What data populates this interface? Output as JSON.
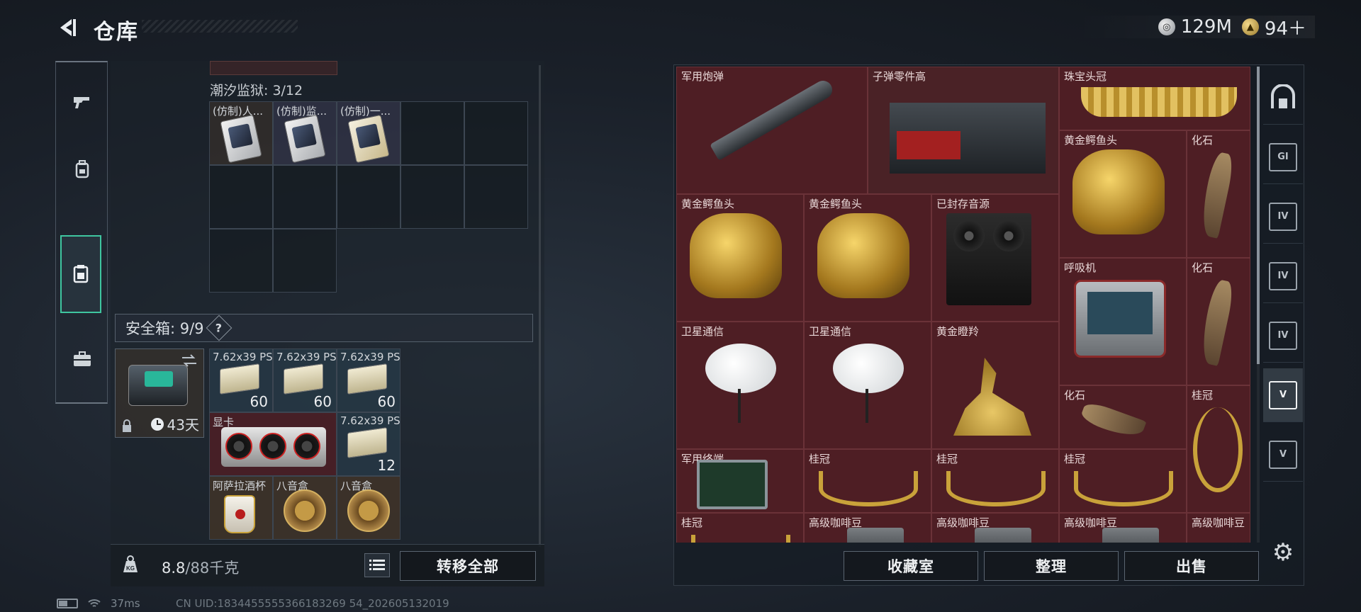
{
  "header": {
    "title": "仓库",
    "currencies": [
      {
        "icon": "silver-coin-icon",
        "value": "129M"
      },
      {
        "icon": "gold-coin-icon",
        "value": "94＋"
      }
    ]
  },
  "left_nav": [
    "gun-icon",
    "backpack-icon",
    "storage-icon",
    "briefcase-icon"
  ],
  "container": {
    "label": "潮汐监狱: 3/12",
    "cells": [
      {
        "label": "(仿制)人..."
      },
      {
        "label": "(仿制)监..."
      },
      {
        "label": "(仿制)一..."
      }
    ]
  },
  "safe": {
    "label": "安全箱: 9/9",
    "help": "?",
    "days": "43天",
    "items": [
      {
        "label": "7.62x39 PS",
        "count": "60"
      },
      {
        "label": "7.62x39 PS",
        "count": "60"
      },
      {
        "label": "7.62x39 PS",
        "count": "60"
      },
      {
        "label": "显卡",
        "count": ""
      },
      {
        "label": "7.62x39 PS",
        "count": "12"
      },
      {
        "label": "阿萨拉酒杯",
        "count": ""
      },
      {
        "label": "八音盒",
        "count": ""
      },
      {
        "label": "八音盒",
        "count": ""
      }
    ]
  },
  "weight": {
    "current": "8.8",
    "max": "/88千克"
  },
  "buttons": {
    "transfer_all": "转移全部",
    "collection": "收藏室",
    "sort": "整理",
    "sell": "出售"
  },
  "stash": [
    {
      "label": "军用炮弹"
    },
    {
      "label": "子弹零件高"
    },
    {
      "label": "珠宝头冠"
    },
    {
      "label": "黄金鳄鱼头"
    },
    {
      "label": "化石"
    },
    {
      "label": "黄金鳄鱼头"
    },
    {
      "label": "黄金鳄鱼头"
    },
    {
      "label": "已封存音源"
    },
    {
      "label": "呼吸机"
    },
    {
      "label": "化石"
    },
    {
      "label": "卫星通信"
    },
    {
      "label": "卫星通信"
    },
    {
      "label": "黄金瞪羚"
    },
    {
      "label": "化石"
    },
    {
      "label": "桂冠"
    },
    {
      "label": "军用终端"
    },
    {
      "label": "桂冠"
    },
    {
      "label": "桂冠"
    },
    {
      "label": "桂冠"
    },
    {
      "label": "桂冠"
    },
    {
      "label": "高级咖啡豆"
    },
    {
      "label": "高级咖啡豆"
    },
    {
      "label": "高级咖啡豆"
    },
    {
      "label": "高级咖啡豆"
    }
  ],
  "right_nav": [
    "vault-door-icon",
    "GI",
    "IV",
    "IV",
    "IV",
    "V",
    "V",
    "settings-icon"
  ],
  "status": {
    "ping": "37ms",
    "uid": "CN UID:1834455555366183269 54_202605132019"
  }
}
